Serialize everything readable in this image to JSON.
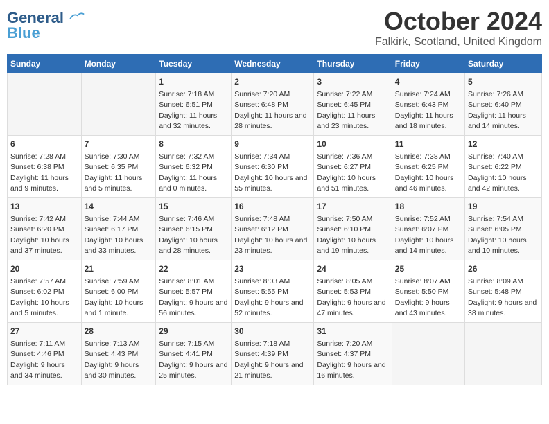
{
  "logo": {
    "line1": "General",
    "line2": "Blue"
  },
  "title": "October 2024",
  "location": "Falkirk, Scotland, United Kingdom",
  "days_of_week": [
    "Sunday",
    "Monday",
    "Tuesday",
    "Wednesday",
    "Thursday",
    "Friday",
    "Saturday"
  ],
  "weeks": [
    [
      {
        "day": "",
        "sunrise": "",
        "sunset": "",
        "daylight": ""
      },
      {
        "day": "",
        "sunrise": "",
        "sunset": "",
        "daylight": ""
      },
      {
        "day": "1",
        "sunrise": "Sunrise: 7:18 AM",
        "sunset": "Sunset: 6:51 PM",
        "daylight": "Daylight: 11 hours and 32 minutes."
      },
      {
        "day": "2",
        "sunrise": "Sunrise: 7:20 AM",
        "sunset": "Sunset: 6:48 PM",
        "daylight": "Daylight: 11 hours and 28 minutes."
      },
      {
        "day": "3",
        "sunrise": "Sunrise: 7:22 AM",
        "sunset": "Sunset: 6:45 PM",
        "daylight": "Daylight: 11 hours and 23 minutes."
      },
      {
        "day": "4",
        "sunrise": "Sunrise: 7:24 AM",
        "sunset": "Sunset: 6:43 PM",
        "daylight": "Daylight: 11 hours and 18 minutes."
      },
      {
        "day": "5",
        "sunrise": "Sunrise: 7:26 AM",
        "sunset": "Sunset: 6:40 PM",
        "daylight": "Daylight: 11 hours and 14 minutes."
      }
    ],
    [
      {
        "day": "6",
        "sunrise": "Sunrise: 7:28 AM",
        "sunset": "Sunset: 6:38 PM",
        "daylight": "Daylight: 11 hours and 9 minutes."
      },
      {
        "day": "7",
        "sunrise": "Sunrise: 7:30 AM",
        "sunset": "Sunset: 6:35 PM",
        "daylight": "Daylight: 11 hours and 5 minutes."
      },
      {
        "day": "8",
        "sunrise": "Sunrise: 7:32 AM",
        "sunset": "Sunset: 6:32 PM",
        "daylight": "Daylight: 11 hours and 0 minutes."
      },
      {
        "day": "9",
        "sunrise": "Sunrise: 7:34 AM",
        "sunset": "Sunset: 6:30 PM",
        "daylight": "Daylight: 10 hours and 55 minutes."
      },
      {
        "day": "10",
        "sunrise": "Sunrise: 7:36 AM",
        "sunset": "Sunset: 6:27 PM",
        "daylight": "Daylight: 10 hours and 51 minutes."
      },
      {
        "day": "11",
        "sunrise": "Sunrise: 7:38 AM",
        "sunset": "Sunset: 6:25 PM",
        "daylight": "Daylight: 10 hours and 46 minutes."
      },
      {
        "day": "12",
        "sunrise": "Sunrise: 7:40 AM",
        "sunset": "Sunset: 6:22 PM",
        "daylight": "Daylight: 10 hours and 42 minutes."
      }
    ],
    [
      {
        "day": "13",
        "sunrise": "Sunrise: 7:42 AM",
        "sunset": "Sunset: 6:20 PM",
        "daylight": "Daylight: 10 hours and 37 minutes."
      },
      {
        "day": "14",
        "sunrise": "Sunrise: 7:44 AM",
        "sunset": "Sunset: 6:17 PM",
        "daylight": "Daylight: 10 hours and 33 minutes."
      },
      {
        "day": "15",
        "sunrise": "Sunrise: 7:46 AM",
        "sunset": "Sunset: 6:15 PM",
        "daylight": "Daylight: 10 hours and 28 minutes."
      },
      {
        "day": "16",
        "sunrise": "Sunrise: 7:48 AM",
        "sunset": "Sunset: 6:12 PM",
        "daylight": "Daylight: 10 hours and 23 minutes."
      },
      {
        "day": "17",
        "sunrise": "Sunrise: 7:50 AM",
        "sunset": "Sunset: 6:10 PM",
        "daylight": "Daylight: 10 hours and 19 minutes."
      },
      {
        "day": "18",
        "sunrise": "Sunrise: 7:52 AM",
        "sunset": "Sunset: 6:07 PM",
        "daylight": "Daylight: 10 hours and 14 minutes."
      },
      {
        "day": "19",
        "sunrise": "Sunrise: 7:54 AM",
        "sunset": "Sunset: 6:05 PM",
        "daylight": "Daylight: 10 hours and 10 minutes."
      }
    ],
    [
      {
        "day": "20",
        "sunrise": "Sunrise: 7:57 AM",
        "sunset": "Sunset: 6:02 PM",
        "daylight": "Daylight: 10 hours and 5 minutes."
      },
      {
        "day": "21",
        "sunrise": "Sunrise: 7:59 AM",
        "sunset": "Sunset: 6:00 PM",
        "daylight": "Daylight: 10 hours and 1 minute."
      },
      {
        "day": "22",
        "sunrise": "Sunrise: 8:01 AM",
        "sunset": "Sunset: 5:57 PM",
        "daylight": "Daylight: 9 hours and 56 minutes."
      },
      {
        "day": "23",
        "sunrise": "Sunrise: 8:03 AM",
        "sunset": "Sunset: 5:55 PM",
        "daylight": "Daylight: 9 hours and 52 minutes."
      },
      {
        "day": "24",
        "sunrise": "Sunrise: 8:05 AM",
        "sunset": "Sunset: 5:53 PM",
        "daylight": "Daylight: 9 hours and 47 minutes."
      },
      {
        "day": "25",
        "sunrise": "Sunrise: 8:07 AM",
        "sunset": "Sunset: 5:50 PM",
        "daylight": "Daylight: 9 hours and 43 minutes."
      },
      {
        "day": "26",
        "sunrise": "Sunrise: 8:09 AM",
        "sunset": "Sunset: 5:48 PM",
        "daylight": "Daylight: 9 hours and 38 minutes."
      }
    ],
    [
      {
        "day": "27",
        "sunrise": "Sunrise: 7:11 AM",
        "sunset": "Sunset: 4:46 PM",
        "daylight": "Daylight: 9 hours and 34 minutes."
      },
      {
        "day": "28",
        "sunrise": "Sunrise: 7:13 AM",
        "sunset": "Sunset: 4:43 PM",
        "daylight": "Daylight: 9 hours and 30 minutes."
      },
      {
        "day": "29",
        "sunrise": "Sunrise: 7:15 AM",
        "sunset": "Sunset: 4:41 PM",
        "daylight": "Daylight: 9 hours and 25 minutes."
      },
      {
        "day": "30",
        "sunrise": "Sunrise: 7:18 AM",
        "sunset": "Sunset: 4:39 PM",
        "daylight": "Daylight: 9 hours and 21 minutes."
      },
      {
        "day": "31",
        "sunrise": "Sunrise: 7:20 AM",
        "sunset": "Sunset: 4:37 PM",
        "daylight": "Daylight: 9 hours and 16 minutes."
      },
      {
        "day": "",
        "sunrise": "",
        "sunset": "",
        "daylight": ""
      },
      {
        "day": "",
        "sunrise": "",
        "sunset": "",
        "daylight": ""
      }
    ]
  ]
}
